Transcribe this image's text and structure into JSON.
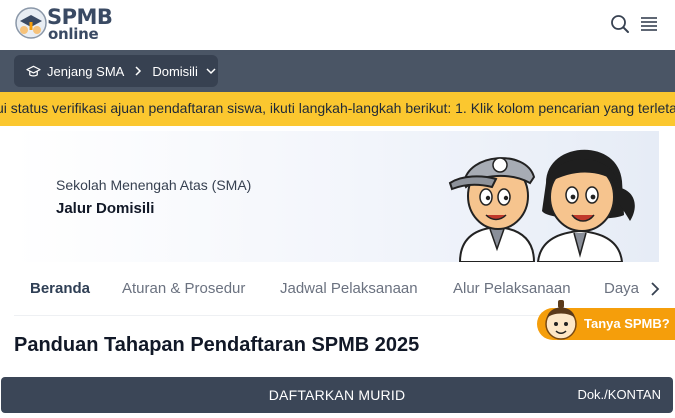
{
  "header": {
    "logo": {
      "text_main": "SPMB",
      "text_sub": "online"
    },
    "icons": [
      "search-icon",
      "menu-icon"
    ]
  },
  "breadcrumb": {
    "level": "Jenjang SMA",
    "route": "Domisili"
  },
  "ticker": {
    "text": "ui status verifikasi ajuan pendaftaran siswa, ikuti langkah-langkah berikut: 1. Klik kolom pencarian yang terletak"
  },
  "hero": {
    "subtitle": "Sekolah Menengah Atas (SMA)",
    "title": "Jalur Domisili"
  },
  "tabs": [
    {
      "label": "Beranda",
      "active": true
    },
    {
      "label": "Aturan & Prosedur",
      "active": false
    },
    {
      "label": "Jadwal Pelaksanaan",
      "active": false
    },
    {
      "label": "Alur Pelaksanaan",
      "active": false
    },
    {
      "label": "Daya",
      "active": false
    }
  ],
  "main": {
    "heading": "Panduan Tahapan Pendaftaran SPMB 2025"
  },
  "help": {
    "label": "Tanya SPMB?"
  },
  "cta": {
    "label": "DAFTARKAN MURID",
    "credit": "Dok./KONTAN"
  },
  "colors": {
    "accent_yellow": "#fbc72f",
    "nav_dark": "#4a5565",
    "cta_dark": "#3b4657",
    "help_orange": "#f59e0b"
  }
}
